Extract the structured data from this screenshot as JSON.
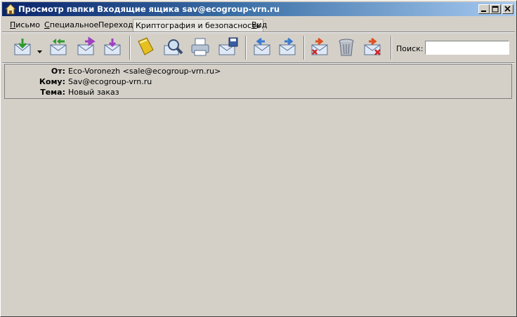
{
  "window": {
    "title": "Просмотр папки Входящие ящика sav@ecogroup-vrn.ru"
  },
  "caption_buttons": {
    "minimize": "minimize-icon",
    "maximize": "maximize-icon",
    "close": "close-icon"
  },
  "menu": {
    "items": [
      {
        "label": "Письмо",
        "underline": "П",
        "rest": "исьмо"
      },
      {
        "label": "Специальное",
        "underline": "С",
        "rest": "пециальное"
      },
      {
        "label": "Переход",
        "underline": "",
        "rest": "Переход"
      },
      {
        "label": "Криптография и безопасность",
        "underline": "",
        "rest": "Криптография и безопасность"
      },
      {
        "label": "Вид",
        "underline": "В",
        "rest": "ид"
      }
    ]
  },
  "toolbar": {
    "icons": [
      "get-mail-icon",
      "reply-all-icon",
      "forward-icon",
      "new-message-icon",
      "address-book-icon",
      "find-icon",
      "print-icon",
      "save-icon",
      "previous-icon",
      "next-icon",
      "delete-message-icon",
      "trash-icon",
      "mark-junk-icon"
    ],
    "search_label": "Поиск:",
    "search_value": ""
  },
  "message": {
    "from_label": "От:",
    "from_value": "Eco-Voronezh <sale@ecogroup-vrn.ru>",
    "to_label": "Кому:",
    "to_value": "Sav@ecogroup-vrn.ru",
    "subject_label": "Тема:",
    "subject_value": "Новый заказ"
  },
  "colors": {
    "titlebar_start": "#0a246a",
    "titlebar_end": "#a6caf0",
    "face": "#d4d0c8"
  }
}
